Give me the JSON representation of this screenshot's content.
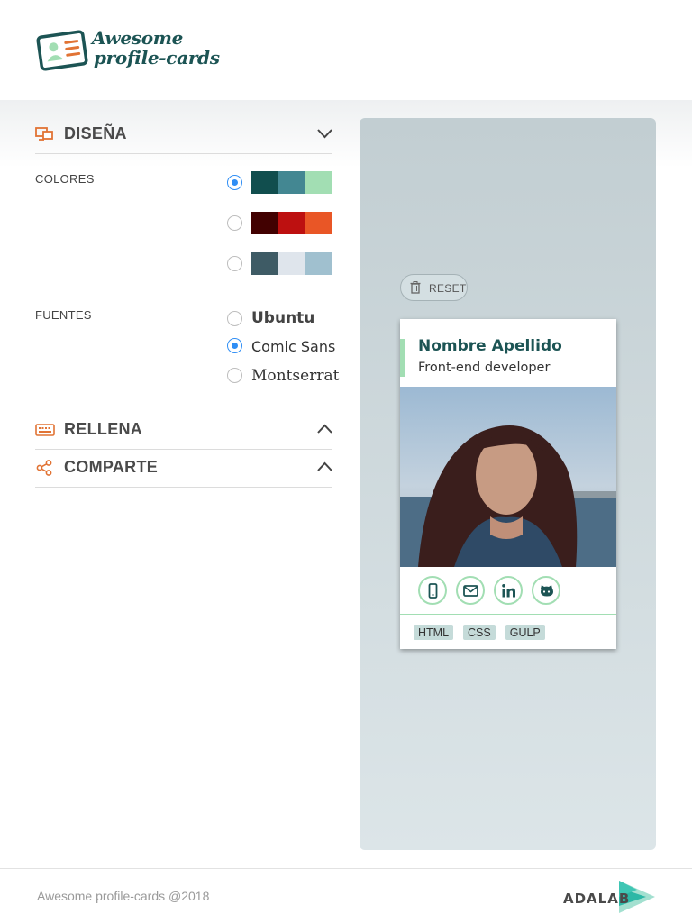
{
  "app": {
    "logo_line1": "Awesome",
    "logo_line2": "profile-cards"
  },
  "sections": {
    "design": {
      "title": "DISEÑA",
      "icon": "screens-icon",
      "expanded": true
    },
    "fill": {
      "title": "RELLENA",
      "icon": "keyboard-icon",
      "expanded": false
    },
    "share": {
      "title": "COMPARTE",
      "icon": "share-icon",
      "expanded": false
    }
  },
  "colors": {
    "label": "COLORES",
    "palettes": [
      {
        "selected": true,
        "swatches": [
          "#114e4e",
          "#438792",
          "#a2deb3"
        ]
      },
      {
        "selected": false,
        "swatches": [
          "#420101",
          "#bd1010",
          "#e95626"
        ]
      },
      {
        "selected": false,
        "swatches": [
          "#3e5b65",
          "#dfe5ec",
          "#a0c0cf"
        ]
      }
    ]
  },
  "fonts": {
    "label": "FUENTES",
    "options": [
      {
        "name": "Ubuntu",
        "selected": false
      },
      {
        "name": "Comic Sans",
        "selected": true
      },
      {
        "name": "Montserrat",
        "selected": false
      }
    ]
  },
  "preview": {
    "reset_label": "RESET",
    "card": {
      "name": "Nombre Apellido",
      "job": "Front-end developer",
      "social": [
        "mobile-icon",
        "mail-icon",
        "linkedin-icon",
        "github-icon"
      ],
      "tags": [
        "HTML",
        "CSS",
        "GULP"
      ]
    }
  },
  "footer": {
    "copyright": "Awesome profile-cards @2018",
    "brand": "ADALAB"
  },
  "theme": {
    "accent": "#e17334",
    "dark_green": "#1c5454",
    "light_green": "#a2deb3",
    "radio_blue": "#2f8ef5"
  }
}
